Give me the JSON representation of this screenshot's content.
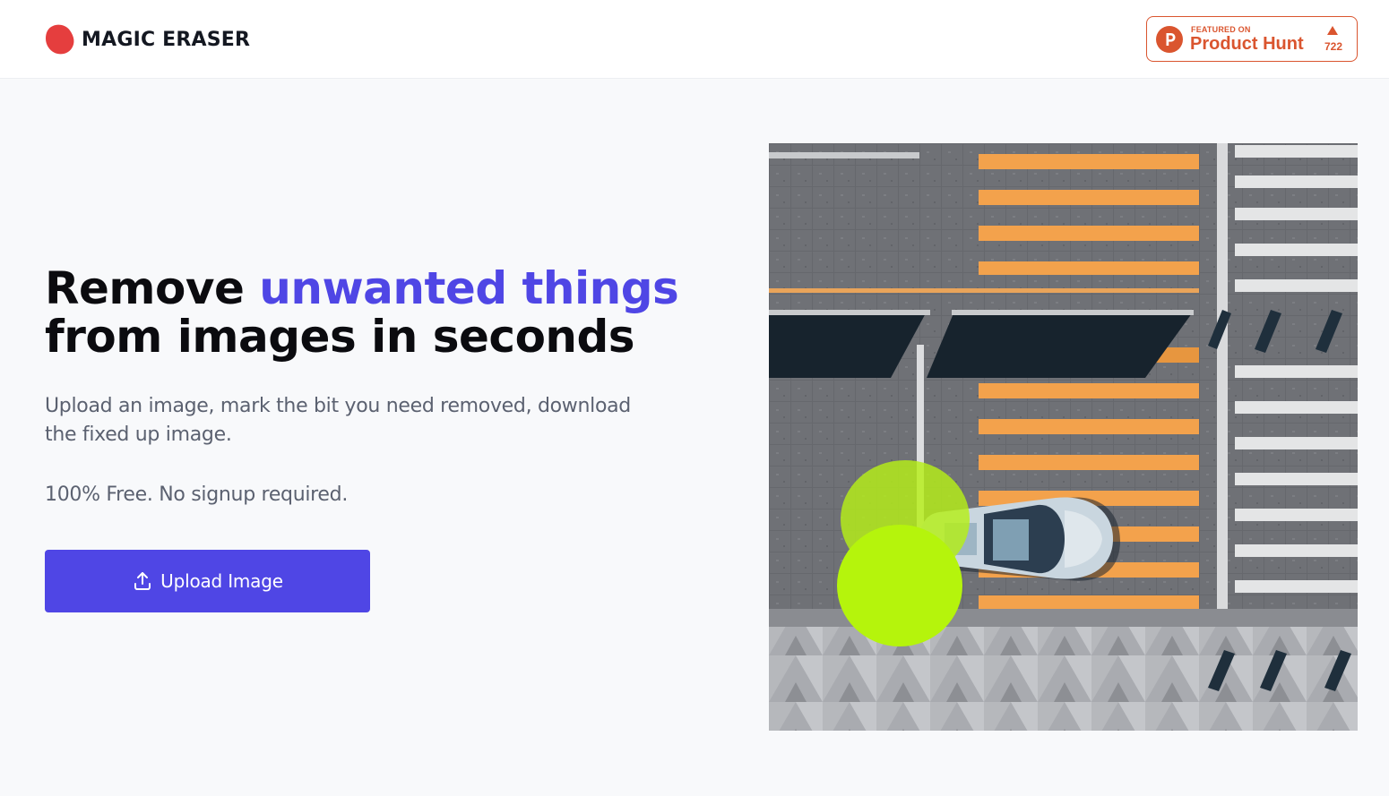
{
  "brand": {
    "name": "MAGIC ERASER",
    "logo_icon": "red-blob-icon",
    "logo_color": "#e53e3e"
  },
  "product_hunt": {
    "featured_label": "FEATURED ON",
    "name": "Product Hunt",
    "upvotes": "722",
    "color": "#da552f"
  },
  "hero": {
    "title_part1": "Remove ",
    "title_accent": "unwanted things",
    "title_part2": "from images in seconds",
    "description": "Upload an image, mark the bit you need removed, download the fixed up image.",
    "free_note": "100% Free. No signup required.",
    "upload_button": "Upload Image",
    "upload_icon": "upload-icon",
    "accent_color": "#4f46e5"
  }
}
